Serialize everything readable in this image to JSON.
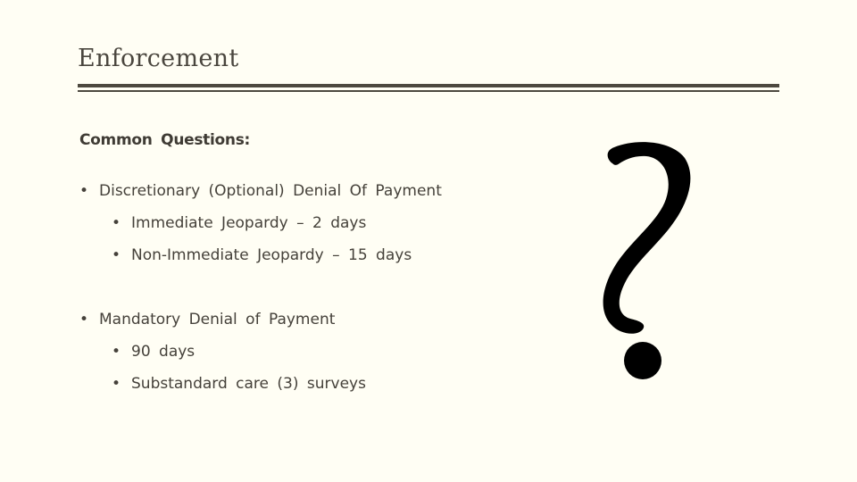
{
  "slide": {
    "title": "Enforcement",
    "subheading": "Common Questions:",
    "bullet_glyph": "•",
    "sections": [
      {
        "label": "Discretionary (Optional) Denial Of Payment",
        "items": [
          "Immediate Jeopardy – 2 days",
          "Non-Immediate Jeopardy – 15 days"
        ]
      },
      {
        "label": "Mandatory Denial of Payment",
        "items": [
          "90 days",
          "Substandard care (3) surveys"
        ]
      }
    ],
    "illustration": "question-mark-icon"
  }
}
